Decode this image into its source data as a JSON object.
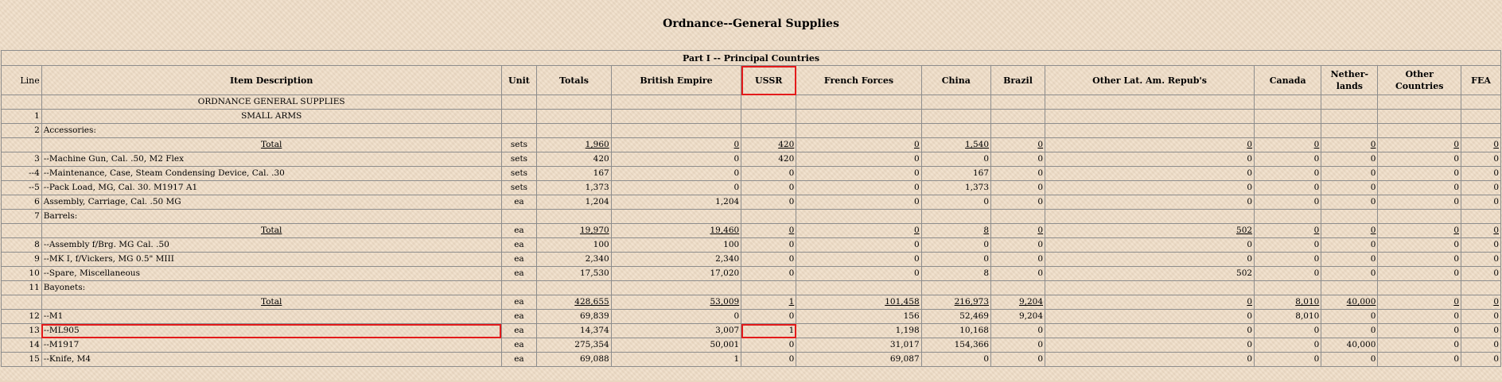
{
  "page": {
    "title": "Ordnance--General Supplies"
  },
  "table": {
    "part_title": "Part I -- Principal Countries",
    "headers": {
      "line": "Line",
      "item": "Item Description",
      "unit": "Unit",
      "totals": "Totals",
      "british": "British Empire",
      "ussr": "USSR",
      "french": "French Forces",
      "china": "China",
      "brazil": "Brazil",
      "latam": "Other Lat. Am. Repub's",
      "canada": "Canada",
      "netherlands": "Nether-lands",
      "other": "Other Countries",
      "fea": "FEA"
    },
    "rows": [
      {
        "line": "",
        "item": "ORDNANCE GENERAL SUPPLIES",
        "unit": "",
        "totals": "",
        "british": "",
        "ussr": "",
        "french": "",
        "china": "",
        "brazil": "",
        "latam": "",
        "canada": "",
        "netherlands": "",
        "other": "",
        "fea": ""
      },
      {
        "line": "1",
        "item": "SMALL ARMS",
        "unit": "",
        "totals": "",
        "british": "",
        "ussr": "",
        "french": "",
        "china": "",
        "brazil": "",
        "latam": "",
        "canada": "",
        "netherlands": "",
        "other": "",
        "fea": ""
      },
      {
        "line": "2",
        "item": "Accessories:",
        "unit": "",
        "totals": "",
        "british": "",
        "ussr": "",
        "french": "",
        "china": "",
        "brazil": "",
        "latam": "",
        "canada": "",
        "netherlands": "",
        "other": "",
        "fea": ""
      },
      {
        "line": "",
        "item": "Total",
        "unit": "sets",
        "totals": "1,960",
        "british": "0",
        "ussr": "420",
        "french": "0",
        "china": "1,540",
        "brazil": "0",
        "latam": "0",
        "canada": "0",
        "netherlands": "0",
        "other": "0",
        "fea": "0"
      },
      {
        "line": "3",
        "item": "--Machine Gun, Cal. .50, M2 Flex",
        "unit": "sets",
        "totals": "420",
        "british": "0",
        "ussr": "420",
        "french": "0",
        "china": "0",
        "brazil": "0",
        "latam": "0",
        "canada": "0",
        "netherlands": "0",
        "other": "0",
        "fea": "0"
      },
      {
        "line": "--4",
        "item": "--Maintenance, Case, Steam Condensing Device, Cal. .30",
        "unit": "sets",
        "totals": "167",
        "british": "0",
        "ussr": "0",
        "french": "0",
        "china": "167",
        "brazil": "0",
        "latam": "0",
        "canada": "0",
        "netherlands": "0",
        "other": "0",
        "fea": "0"
      },
      {
        "line": "--5",
        "item": "--Pack Load, MG, Cal. 30. M1917 A1",
        "unit": "sets",
        "totals": "1,373",
        "british": "0",
        "ussr": "0",
        "french": "0",
        "china": "1,373",
        "brazil": "0",
        "latam": "0",
        "canada": "0",
        "netherlands": "0",
        "other": "0",
        "fea": "0"
      },
      {
        "line": "6",
        "item": "Assembly, Carriage, Cal. .50 MG",
        "unit": "ea",
        "totals": "1,204",
        "british": "1,204",
        "ussr": "0",
        "french": "0",
        "china": "0",
        "brazil": "0",
        "latam": "0",
        "canada": "0",
        "netherlands": "0",
        "other": "0",
        "fea": "0"
      },
      {
        "line": "7",
        "item": "Barrels:",
        "unit": "",
        "totals": "",
        "british": "",
        "ussr": "",
        "french": "",
        "china": "",
        "brazil": "",
        "latam": "",
        "canada": "",
        "netherlands": "",
        "other": "",
        "fea": ""
      },
      {
        "line": "",
        "item": "Total",
        "unit": "ea",
        "totals": "19,970",
        "british": "19,460",
        "ussr": "0",
        "french": "0",
        "china": "8",
        "brazil": "0",
        "latam": "502",
        "canada": "0",
        "netherlands": "0",
        "other": "0",
        "fea": "0"
      },
      {
        "line": "8",
        "item": "--Assembly f/Brg. MG Cal. .50",
        "unit": "ea",
        "totals": "100",
        "british": "100",
        "ussr": "0",
        "french": "0",
        "china": "0",
        "brazil": "0",
        "latam": "0",
        "canada": "0",
        "netherlands": "0",
        "other": "0",
        "fea": "0"
      },
      {
        "line": "9",
        "item": "--MK I, f/Vickers, MG 0.5\" MIII",
        "unit": "ea",
        "totals": "2,340",
        "british": "2,340",
        "ussr": "0",
        "french": "0",
        "china": "0",
        "brazil": "0",
        "latam": "0",
        "canada": "0",
        "netherlands": "0",
        "other": "0",
        "fea": "0"
      },
      {
        "line": "10",
        "item": "--Spare, Miscellaneous",
        "unit": "ea",
        "totals": "17,530",
        "british": "17,020",
        "ussr": "0",
        "french": "0",
        "china": "8",
        "brazil": "0",
        "latam": "502",
        "canada": "0",
        "netherlands": "0",
        "other": "0",
        "fea": "0"
      },
      {
        "line": "11",
        "item": "Bayonets:",
        "unit": "",
        "totals": "",
        "british": "",
        "ussr": "",
        "french": "",
        "china": "",
        "brazil": "",
        "latam": "",
        "canada": "",
        "netherlands": "",
        "other": "",
        "fea": ""
      },
      {
        "line": "",
        "item": "Total",
        "unit": "ea",
        "totals": "428,655",
        "british": "53,009",
        "ussr": "1",
        "french": "101,458",
        "china": "216,973",
        "brazil": "9,204",
        "latam": "0",
        "canada": "8,010",
        "netherlands": "40,000",
        "other": "0",
        "fea": "0"
      },
      {
        "line": "12",
        "item": "--M1",
        "unit": "ea",
        "totals": "69,839",
        "british": "0",
        "ussr": "0",
        "french": "156",
        "china": "52,469",
        "brazil": "9,204",
        "latam": "0",
        "canada": "8,010",
        "netherlands": "0",
        "other": "0",
        "fea": "0"
      },
      {
        "line": "13",
        "item": "--ML905",
        "unit": "ea",
        "totals": "14,374",
        "british": "3,007",
        "ussr": "1",
        "french": "1,198",
        "china": "10,168",
        "brazil": "0",
        "latam": "0",
        "canada": "0",
        "netherlands": "0",
        "other": "0",
        "fea": "0"
      },
      {
        "line": "14",
        "item": "--M1917",
        "unit": "ea",
        "totals": "275,354",
        "british": "50,001",
        "ussr": "0",
        "french": "31,017",
        "china": "154,366",
        "brazil": "0",
        "latam": "0",
        "canada": "0",
        "netherlands": "40,000",
        "other": "0",
        "fea": "0"
      },
      {
        "line": "15",
        "item": "--Knife, M4",
        "unit": "ea",
        "totals": "69,088",
        "british": "1",
        "ussr": "0",
        "french": "69,087",
        "china": "0",
        "brazil": "0",
        "latam": "0",
        "canada": "0",
        "netherlands": "0",
        "other": "0",
        "fea": "0"
      }
    ]
  },
  "colors": {
    "background": "#efdcc6",
    "grid": "#8d8d8d",
    "highlight": "#e31b1b"
  }
}
